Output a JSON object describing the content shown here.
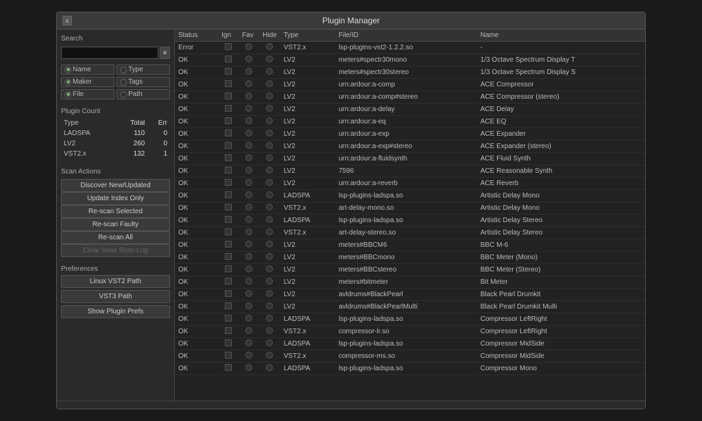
{
  "window": {
    "title": "Plugin Manager",
    "close_label": "x"
  },
  "sidebar": {
    "search_label": "Search",
    "search_placeholder": "",
    "clear_btn": "✕",
    "options": [
      {
        "label": "Name",
        "active": true
      },
      {
        "label": "Type",
        "active": false
      },
      {
        "label": "Maker",
        "active": false
      },
      {
        "label": "Tags",
        "active": false
      },
      {
        "label": "File",
        "active": true
      },
      {
        "label": "Path",
        "active": false
      }
    ],
    "plugin_count": {
      "title": "Plugin Count",
      "headers": [
        "Type",
        "Total",
        "Err"
      ],
      "rows": [
        {
          "type": "LADSPA",
          "total": "110",
          "err": "0"
        },
        {
          "type": "LV2",
          "total": "260",
          "err": "0"
        },
        {
          "type": "VST2.x",
          "total": "132",
          "err": "1"
        }
      ]
    },
    "scan_actions": {
      "title": "Scan Actions",
      "buttons": [
        {
          "label": "Discover New/Updated",
          "disabled": false
        },
        {
          "label": "Update Index Only",
          "disabled": false
        },
        {
          "label": "Re-scan Selected",
          "disabled": false
        },
        {
          "label": "Re-scan Faulty",
          "disabled": false
        },
        {
          "label": "Re-scan All",
          "disabled": false
        },
        {
          "label": "Clear Stale Scan Log",
          "disabled": true
        }
      ]
    },
    "preferences": {
      "title": "Preferences",
      "buttons": [
        {
          "label": "Linux VST2 Path"
        },
        {
          "label": "VST3 Path"
        },
        {
          "label": "Show Plugin Prefs"
        }
      ]
    }
  },
  "table": {
    "columns": [
      "Status",
      "Ign",
      "Fav",
      "Hide",
      "Type",
      "File/ID",
      "Name"
    ],
    "rows": [
      {
        "status": "Error",
        "ign": false,
        "fav": false,
        "hide": false,
        "type": "VST2.x",
        "file": "lsp-plugins-vst2-1.2.2.so",
        "name": "-"
      },
      {
        "status": "OK",
        "ign": false,
        "fav": false,
        "hide": false,
        "type": "LV2",
        "file": "meters#spectr30mono",
        "name": "1/3 Octave Spectrum Display T"
      },
      {
        "status": "OK",
        "ign": false,
        "fav": false,
        "hide": false,
        "type": "LV2",
        "file": "meters#spectr30stereo",
        "name": "1/3 Octave Spectrum Display S"
      },
      {
        "status": "OK",
        "ign": false,
        "fav": false,
        "hide": false,
        "type": "LV2",
        "file": "urn:ardour:a-comp",
        "name": "ACE Compressor"
      },
      {
        "status": "OK",
        "ign": false,
        "fav": false,
        "hide": false,
        "type": "LV2",
        "file": "urn:ardour:a-comp#stereo",
        "name": "ACE Compressor (stereo)"
      },
      {
        "status": "OK",
        "ign": false,
        "fav": false,
        "hide": false,
        "type": "LV2",
        "file": "urn:ardour:a-delay",
        "name": "ACE Delay"
      },
      {
        "status": "OK",
        "ign": false,
        "fav": false,
        "hide": false,
        "type": "LV2",
        "file": "urn:ardour:a-eq",
        "name": "ACE EQ"
      },
      {
        "status": "OK",
        "ign": false,
        "fav": false,
        "hide": false,
        "type": "LV2",
        "file": "urn:ardour:a-exp",
        "name": "ACE Expander"
      },
      {
        "status": "OK",
        "ign": false,
        "fav": false,
        "hide": false,
        "type": "LV2",
        "file": "urn:ardour:a-exp#stereo",
        "name": "ACE Expander (stereo)"
      },
      {
        "status": "OK",
        "ign": false,
        "fav": false,
        "hide": false,
        "type": "LV2",
        "file": "urn:ardour:a-fluidsynth",
        "name": "ACE Fluid Synth"
      },
      {
        "status": "OK",
        "ign": false,
        "fav": false,
        "hide": false,
        "type": "LV2",
        "file": "7596",
        "name": "ACE Reasonable Synth"
      },
      {
        "status": "OK",
        "ign": false,
        "fav": false,
        "hide": false,
        "type": "LV2",
        "file": "urn:ardour:a-reverb",
        "name": "ACE Reverb"
      },
      {
        "status": "OK",
        "ign": false,
        "fav": false,
        "hide": false,
        "type": "LADSPA",
        "file": "lsp-plugins-ladspa.so",
        "name": "Artistic Delay Mono"
      },
      {
        "status": "OK",
        "ign": false,
        "fav": false,
        "hide": false,
        "type": "VST2.x",
        "file": "art-delay-mono.so",
        "name": "Artistic Delay Mono"
      },
      {
        "status": "OK",
        "ign": false,
        "fav": false,
        "hide": false,
        "type": "LADSPA",
        "file": "lsp-plugins-ladspa.so",
        "name": "Artistic Delay Stereo"
      },
      {
        "status": "OK",
        "ign": false,
        "fav": false,
        "hide": false,
        "type": "VST2.x",
        "file": "art-delay-stereo.so",
        "name": "Artistic Delay Stereo"
      },
      {
        "status": "OK",
        "ign": false,
        "fav": false,
        "hide": false,
        "type": "LV2",
        "file": "meters#BBCM6",
        "name": "BBC M-6"
      },
      {
        "status": "OK",
        "ign": false,
        "fav": false,
        "hide": false,
        "type": "LV2",
        "file": "meters#BBCmono",
        "name": "BBC Meter (Mono)"
      },
      {
        "status": "OK",
        "ign": false,
        "fav": false,
        "hide": false,
        "type": "LV2",
        "file": "meters#BBCstereo",
        "name": "BBC Meter (Stereo)"
      },
      {
        "status": "OK",
        "ign": false,
        "fav": false,
        "hide": false,
        "type": "LV2",
        "file": "meters#bitmeter",
        "name": "Bit Meter"
      },
      {
        "status": "OK",
        "ign": false,
        "fav": false,
        "hide": false,
        "type": "LV2",
        "file": "avldrums#BlackPearl",
        "name": "Black Pearl Drumkit"
      },
      {
        "status": "OK",
        "ign": false,
        "fav": false,
        "hide": false,
        "type": "LV2",
        "file": "avldrums#BlackPearlMulti",
        "name": "Black Pearl Drumkit Multi"
      },
      {
        "status": "OK",
        "ign": false,
        "fav": false,
        "hide": false,
        "type": "LADSPA",
        "file": "lsp-plugins-ladspa.so",
        "name": "Compressor LeftRight"
      },
      {
        "status": "OK",
        "ign": false,
        "fav": false,
        "hide": false,
        "type": "VST2.x",
        "file": "compressor-lr.so",
        "name": "Compressor LeftRight"
      },
      {
        "status": "OK",
        "ign": false,
        "fav": false,
        "hide": false,
        "type": "LADSPA",
        "file": "lsp-plugins-ladspa.so",
        "name": "Compressor MidSide"
      },
      {
        "status": "OK",
        "ign": false,
        "fav": false,
        "hide": false,
        "type": "VST2.x",
        "file": "compressor-ms.so",
        "name": "Compressor MidSide"
      },
      {
        "status": "OK",
        "ign": false,
        "fav": false,
        "hide": false,
        "type": "LADSPA",
        "file": "lsp-plugins-ladspa.so",
        "name": "Compressor Mono"
      }
    ]
  }
}
